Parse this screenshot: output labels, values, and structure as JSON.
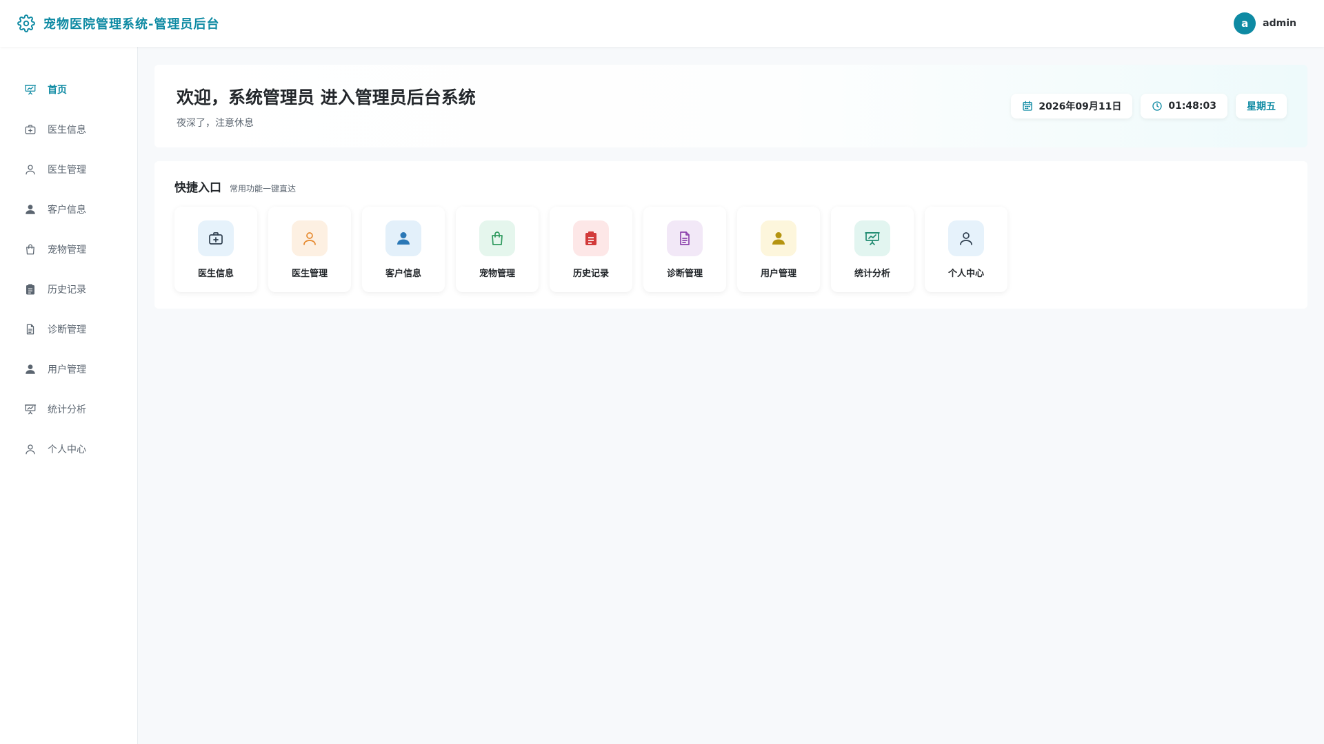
{
  "header": {
    "title": "宠物医院管理系统-管理员后台",
    "avatar_letter": "a",
    "username": "admin"
  },
  "colors": {
    "accent": "#0e8aa3",
    "sidebar_icon": "#5b6570"
  },
  "sidebar": {
    "items": [
      {
        "label": "首页",
        "icon": "presentation-chart-icon",
        "active": true
      },
      {
        "label": "医生信息",
        "icon": "medical-kit-icon"
      },
      {
        "label": "医生管理",
        "icon": "user-outline-icon"
      },
      {
        "label": "客户信息",
        "icon": "user-filled-icon"
      },
      {
        "label": "宠物管理",
        "icon": "shopping-bag-icon"
      },
      {
        "label": "历史记录",
        "icon": "clipboard-icon"
      },
      {
        "label": "诊断管理",
        "icon": "document-icon"
      },
      {
        "label": "用户管理",
        "icon": "user-filled-icon"
      },
      {
        "label": "统计分析",
        "icon": "presentation-chart-icon"
      },
      {
        "label": "个人中心",
        "icon": "user-outline-icon"
      }
    ]
  },
  "welcome": {
    "title": "欢迎，系统管理员 进入管理员后台系统",
    "subtitle": "夜深了，注意休息",
    "date": "2026年09月11日",
    "time": "01:48:03",
    "weekday": "星期五"
  },
  "quick": {
    "title": "快捷入口",
    "subtitle": "常用功能一键直达",
    "tiles": [
      {
        "label": "医生信息",
        "icon": "medical-kit-icon",
        "bg": "#e6f2fb",
        "fg": "#2f3f4f"
      },
      {
        "label": "医生管理",
        "icon": "user-outline-icon",
        "bg": "#fdf0e2",
        "fg": "#e6892e"
      },
      {
        "label": "客户信息",
        "icon": "user-filled-icon",
        "bg": "#e3f0fa",
        "fg": "#2b78b6"
      },
      {
        "label": "宠物管理",
        "icon": "shopping-bag-icon",
        "bg": "#e5f6ed",
        "fg": "#2f9a5f"
      },
      {
        "label": "历史记录",
        "icon": "clipboard-icon",
        "bg": "#fde7e7",
        "fg": "#d23a3a"
      },
      {
        "label": "诊断管理",
        "icon": "document-icon",
        "bg": "#f2e8f7",
        "fg": "#8e44ad"
      },
      {
        "label": "用户管理",
        "icon": "user-filled-icon",
        "bg": "#fdf6dc",
        "fg": "#b59410"
      },
      {
        "label": "统计分析",
        "icon": "presentation-chart-icon",
        "bg": "#e2f5f0",
        "fg": "#1f8a70"
      },
      {
        "label": "个人中心",
        "icon": "user-outline-icon",
        "bg": "#e6f2fb",
        "fg": "#2f3f4f"
      }
    ]
  }
}
